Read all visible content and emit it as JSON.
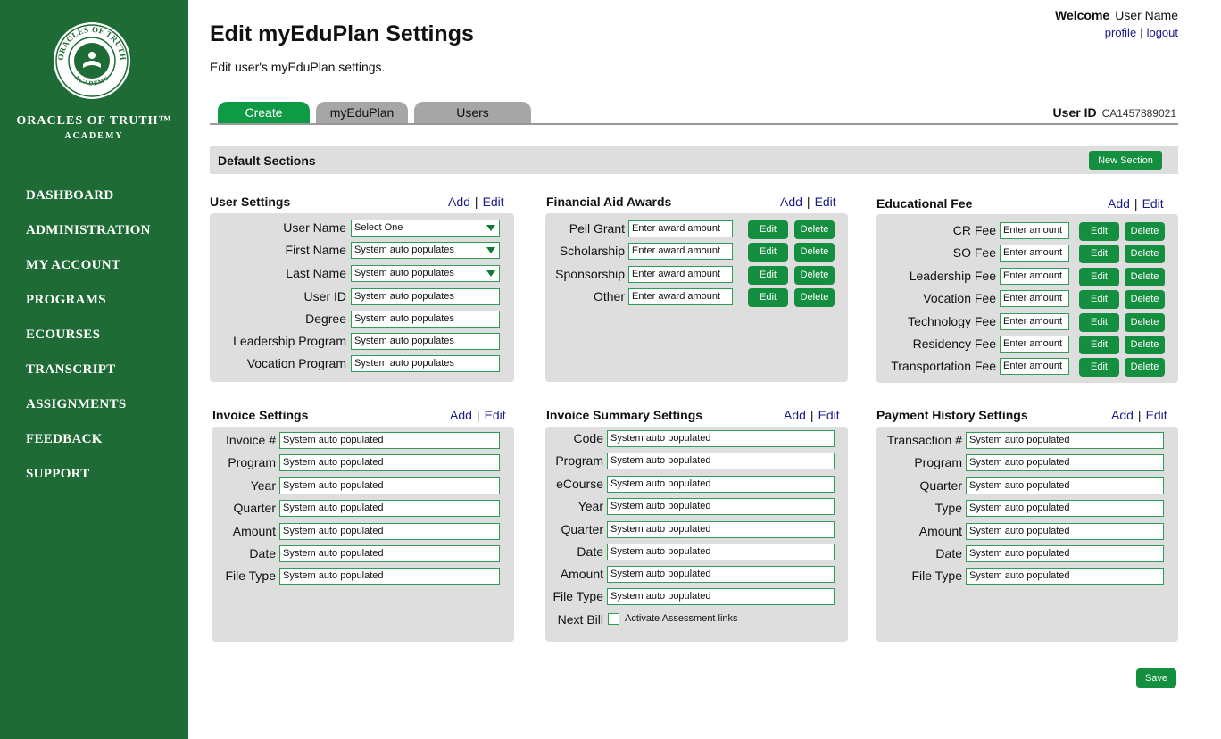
{
  "brand": {
    "seal_top": "ORACLES OF TRUTH",
    "seal_bottom": "ACADEMY",
    "name": "ORACLES OF TRUTH™",
    "sub": "ACADEMY"
  },
  "nav": [
    "DASHBOARD",
    "ADMINISTRATION",
    "MY ACCOUNT",
    "PROGRAMS",
    "ECOURSES",
    "TRANSCRIPT",
    "ASSIGNMENTS",
    "FEEDBACK",
    "SUPPORT"
  ],
  "header": {
    "title": "Edit myEduPlan Settings",
    "description": "Edit user's myEduPlan settings.",
    "welcome_label": "Welcome",
    "user_name": "User Name",
    "profile": "profile",
    "link_sep": "|",
    "logout": "logout"
  },
  "tabs": [
    "Create",
    "myEduPlan",
    "Users"
  ],
  "user_id": {
    "label": "User ID",
    "value": "CA1457889021"
  },
  "default_sections": {
    "label": "Default Sections",
    "button": "New Section"
  },
  "actions": {
    "add": "Add",
    "sep": "|",
    "edit": "Edit",
    "row_edit": "Edit",
    "row_delete": "Delete",
    "save": "Save"
  },
  "user_settings": {
    "title": "User Settings",
    "rows": [
      {
        "label": "User Name",
        "value": "Select One"
      },
      {
        "label": "First Name",
        "value": "System auto populates"
      },
      {
        "label": "Last Name",
        "value": "System auto populates"
      },
      {
        "label": "User ID",
        "value": "System auto populates"
      },
      {
        "label": "Degree",
        "value": "System auto populates"
      },
      {
        "label": "Leadership Program",
        "value": "System auto populates"
      },
      {
        "label": "Vocation Program",
        "value": "System auto populates"
      }
    ]
  },
  "financial_aid": {
    "title": "Financial Aid Awards",
    "rows": [
      {
        "label": "Pell Grant",
        "value": "Enter award amount"
      },
      {
        "label": "Scholarship",
        "value": "Enter award amount"
      },
      {
        "label": "Sponsorship",
        "value": "Enter award amount"
      },
      {
        "label": "Other",
        "value": "Enter award amount"
      }
    ]
  },
  "educational_fee": {
    "title": "Educational Fee",
    "rows": [
      {
        "label": "CR Fee",
        "value": "Enter amount"
      },
      {
        "label": "SO Fee",
        "value": "Enter amount"
      },
      {
        "label": "Leadership Fee",
        "value": "Enter amount"
      },
      {
        "label": "Vocation Fee",
        "value": "Enter amount"
      },
      {
        "label": "Technology Fee",
        "value": "Enter amount"
      },
      {
        "label": "Residency Fee",
        "value": "Enter amount"
      },
      {
        "label": "Transportation Fee",
        "value": "Enter amount"
      }
    ]
  },
  "invoice_settings": {
    "title": "Invoice Settings",
    "rows": [
      {
        "label": "Invoice #",
        "value": "System auto populated"
      },
      {
        "label": "Program",
        "value": "System auto populated"
      },
      {
        "label": "Year",
        "value": "System auto populated"
      },
      {
        "label": "Quarter",
        "value": "System auto populated"
      },
      {
        "label": "Amount",
        "value": "System auto populated"
      },
      {
        "label": "Date",
        "value": "System auto populated"
      },
      {
        "label": "File Type",
        "value": "System auto populated"
      }
    ]
  },
  "invoice_summary": {
    "title": "Invoice Summary Settings",
    "rows": [
      {
        "label": "Code",
        "value": "System auto populated"
      },
      {
        "label": "Program",
        "value": "System auto populated"
      },
      {
        "label": "eCourse",
        "value": "System auto populated"
      },
      {
        "label": "Year",
        "value": "System auto populated"
      },
      {
        "label": "Quarter",
        "value": "System auto populated"
      },
      {
        "label": "Date",
        "value": "System auto populated"
      },
      {
        "label": "Amount",
        "value": "System auto populated"
      },
      {
        "label": "File Type",
        "value": "System auto populated"
      }
    ],
    "next_bill_label": "Next Bill",
    "next_bill_checkbox": "Activate Assessment links"
  },
  "payment_history": {
    "title": "Payment History Settings",
    "rows": [
      {
        "label": "Transaction #",
        "value": "System auto populated"
      },
      {
        "label": "Program",
        "value": "System auto populated"
      },
      {
        "label": "Quarter",
        "value": "System auto populated"
      },
      {
        "label": "Type",
        "value": "System auto populated"
      },
      {
        "label": "Amount",
        "value": "System auto populated"
      },
      {
        "label": "Date",
        "value": "System auto populated"
      },
      {
        "label": "File Type",
        "value": "System auto populated"
      }
    ]
  },
  "colors": {
    "sidebar": "#1f6b35",
    "accent": "#148f3f",
    "panel": "#dedede",
    "link": "#1a1a8c"
  }
}
